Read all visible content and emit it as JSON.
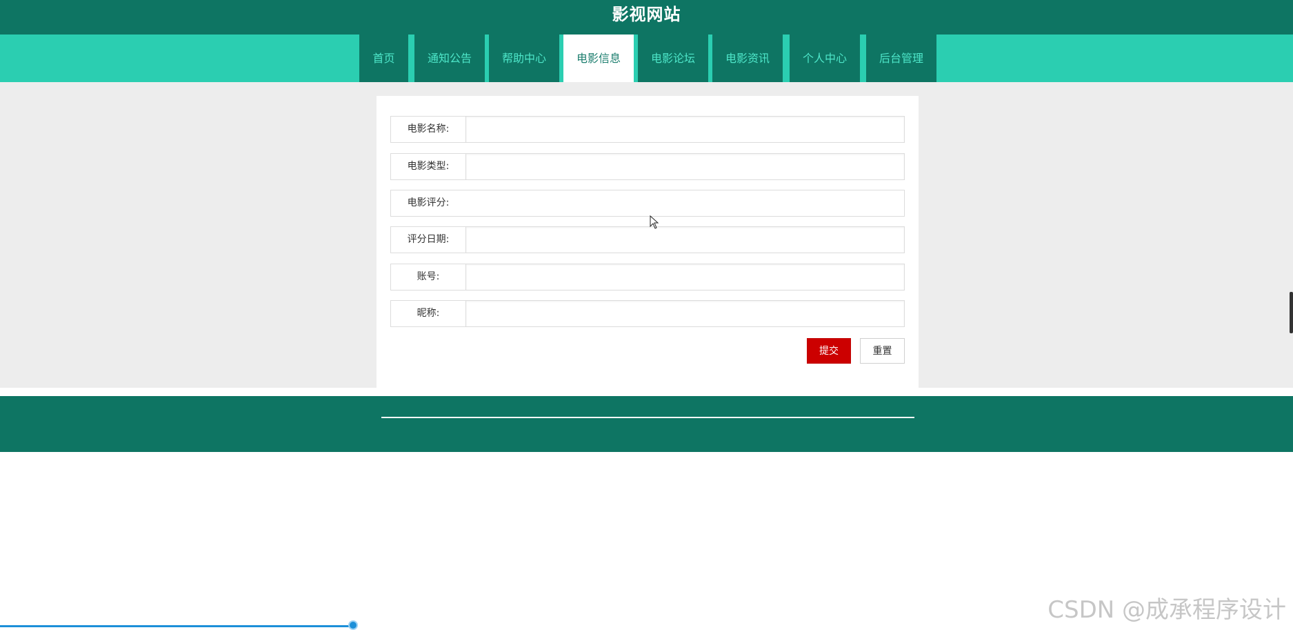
{
  "header": {
    "site_title": "影视网站"
  },
  "nav": {
    "items": [
      {
        "label": "首页"
      },
      {
        "label": "通知公告"
      },
      {
        "label": "帮助中心"
      },
      {
        "label": "电影信息",
        "active": true
      },
      {
        "label": "电影论坛"
      },
      {
        "label": "电影资讯"
      },
      {
        "label": "个人中心"
      },
      {
        "label": "后台管理"
      }
    ]
  },
  "form": {
    "fields": [
      {
        "label": "电影名称:",
        "value": "",
        "has_input": true
      },
      {
        "label": "电影类型:",
        "value": "",
        "has_input": true
      },
      {
        "label": "电影评分:",
        "value": "",
        "has_input": false
      },
      {
        "label": "评分日期:",
        "value": "",
        "has_input": true
      },
      {
        "label": "账号:",
        "value": "",
        "has_input": true
      },
      {
        "label": "昵称:",
        "value": "",
        "has_input": true
      }
    ],
    "submit_label": "提交",
    "reset_label": "重置"
  },
  "colors": {
    "header_bg": "#0e7563",
    "nav_bg": "#2bceb1",
    "nav_text": "#4ee6c9",
    "submit_bg": "#cc0000"
  },
  "watermark": "CSDN @成承程序设计"
}
